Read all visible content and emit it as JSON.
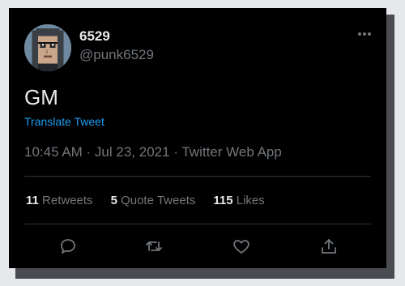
{
  "user": {
    "display_name": "6529",
    "handle": "@punk6529",
    "avatar_icon": "pixel-punk-avatar-icon"
  },
  "tweet": {
    "text": "GM",
    "translate_label": "Translate Tweet",
    "timestamp": "10:45 AM · Jul 23, 2021 · Twitter Web App"
  },
  "stats": {
    "retweets_count": "11",
    "retweets_label": "Retweets",
    "quotes_count": "5",
    "quotes_label": "Quote Tweets",
    "likes_count": "115",
    "likes_label": "Likes"
  },
  "actions": {
    "reply_icon": "reply-icon",
    "retweet_icon": "retweet-icon",
    "like_icon": "like-icon",
    "share_icon": "share-icon"
  },
  "colors": {
    "background": "#000000",
    "text": "#e7e9ea",
    "muted": "#71767b",
    "link": "#1d9bf0",
    "divider": "#2f3336"
  }
}
